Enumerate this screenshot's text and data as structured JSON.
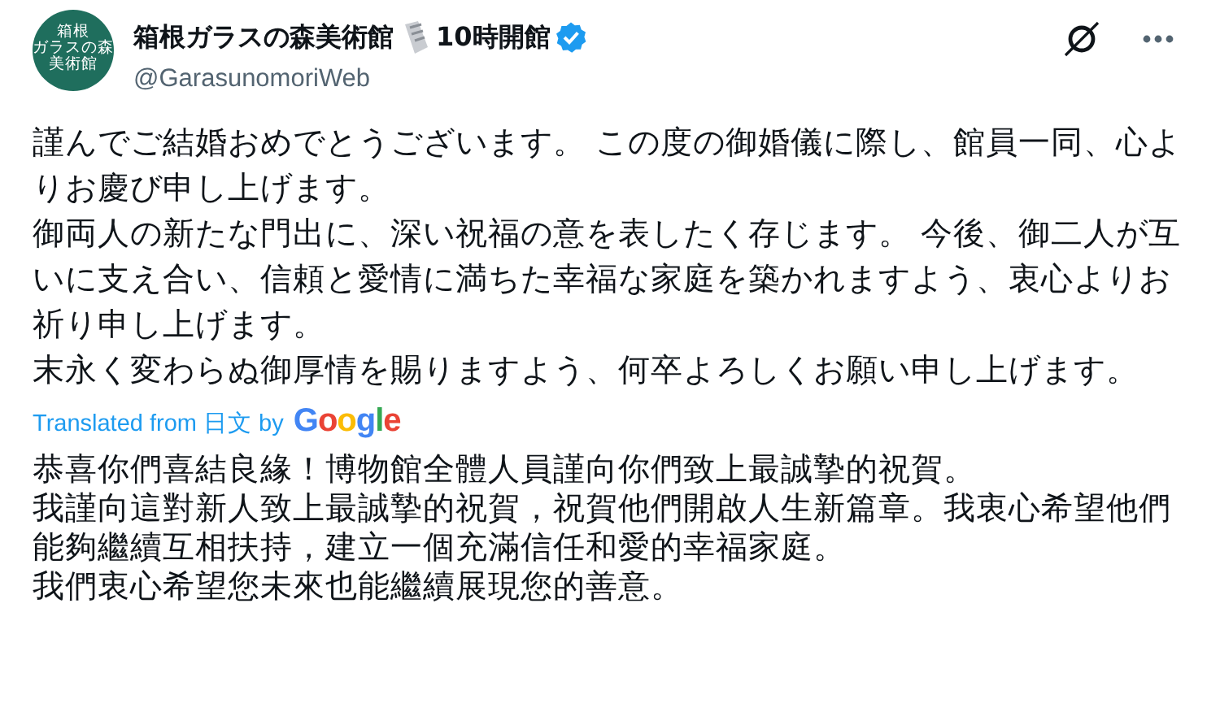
{
  "author": {
    "avatar_lines": [
      "箱根",
      "ガラスの森",
      "美術館"
    ],
    "name": "箱根ガラスの森美術館",
    "name_suffix": "10時開館",
    "verified": true,
    "handle": "@GarasunomoriWeb"
  },
  "post": {
    "paragraphs": [
      "謹んでご結婚おめでとうございます。 この度の御婚儀に際し、館員一同、心よりお慶び申し上げます。",
      "御両人の新たな門出に、深い祝福の意を表したく存じます。 今後、御二人が互いに支え合い、信頼と愛情に満ちた幸福な家庭を築かれますよう、衷心よりお祈り申し上げます。",
      "末永く変わらぬ御厚情を賜りますよう、何卒よろしくお願い申し上げます。"
    ]
  },
  "translation": {
    "label": "Translated from 日文 by",
    "provider": "Google",
    "paragraphs": [
      "恭喜你們喜結良緣！博物館全體人員謹向你們致上最誠摯的祝賀。",
      "我謹向這對新人致上最誠摯的祝賀，祝賀他們開啟人生新篇章。我衷心希望他們能夠繼續互相扶持，建立一個充滿信任和愛的幸福家庭。",
      "我們衷心希望您未來也能繼續展現您的善意。"
    ]
  }
}
